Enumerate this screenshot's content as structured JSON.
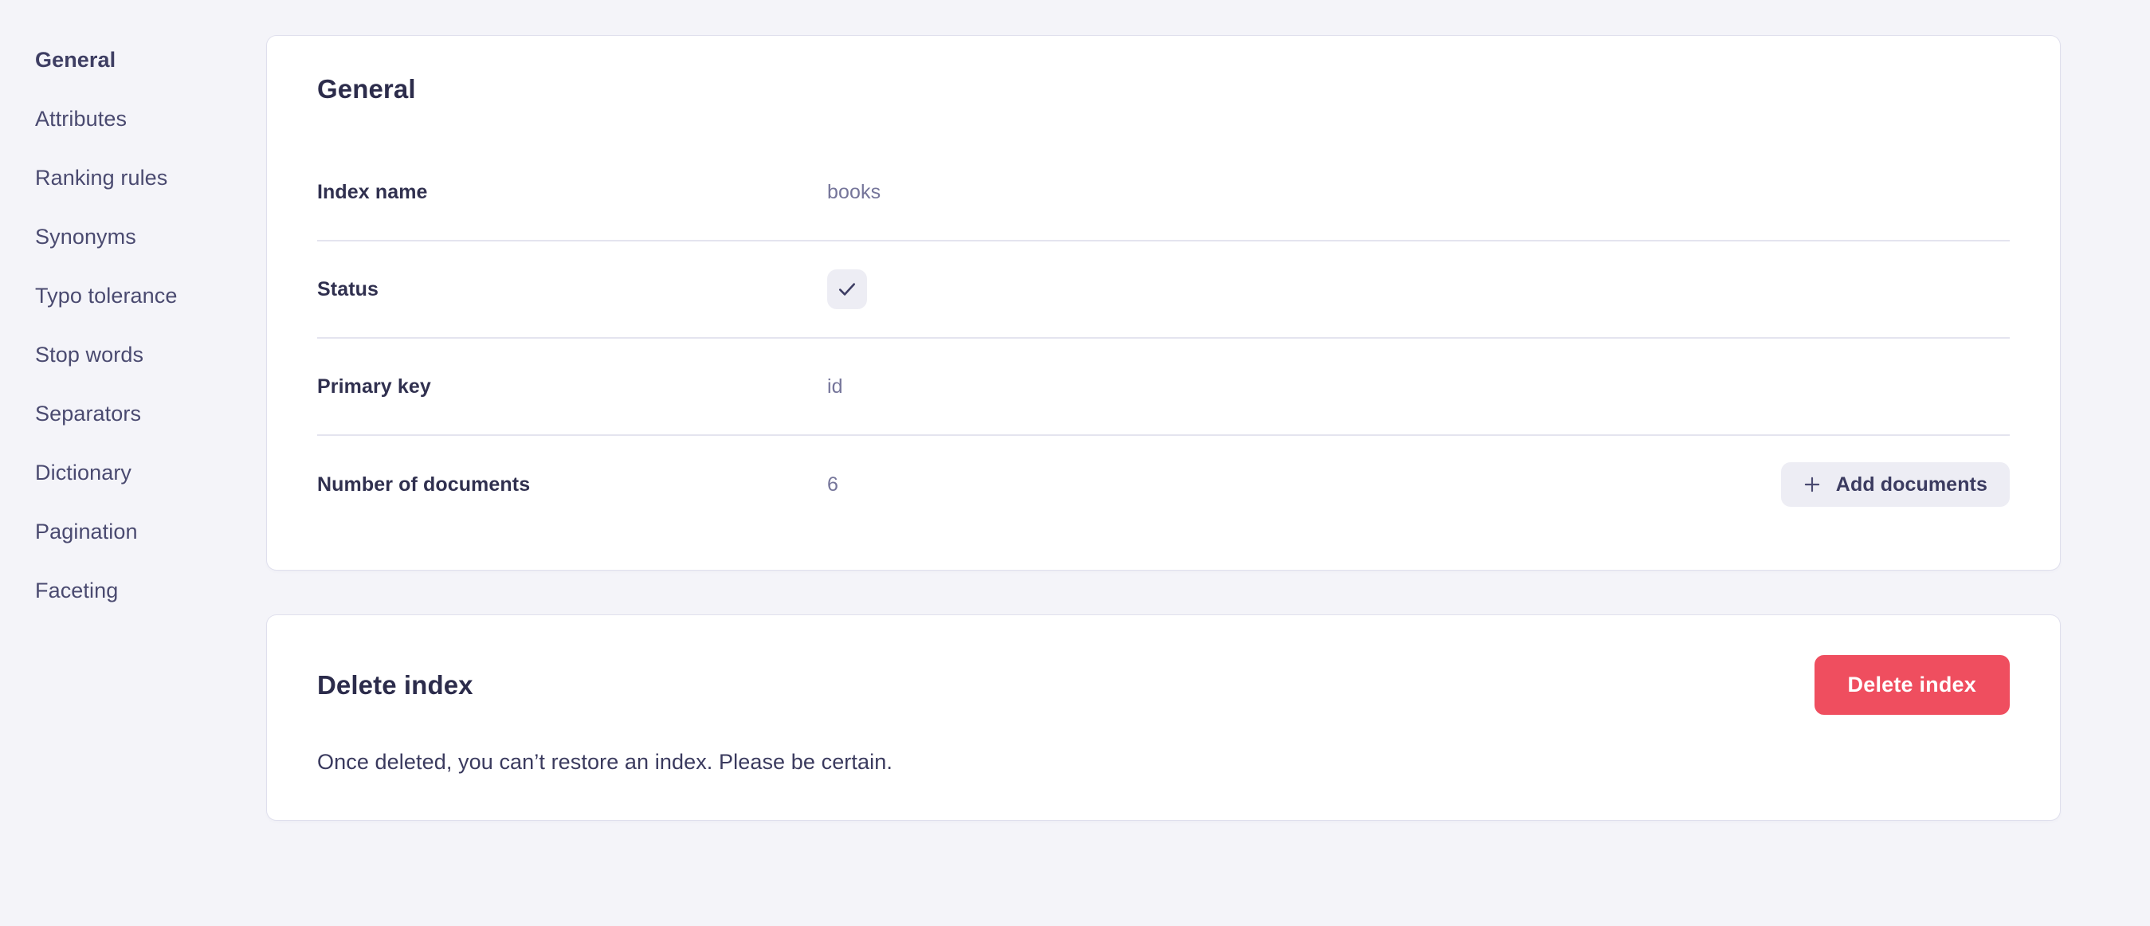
{
  "sidebar": {
    "items": [
      {
        "label": "General",
        "active": true
      },
      {
        "label": "Attributes",
        "active": false
      },
      {
        "label": "Ranking rules",
        "active": false
      },
      {
        "label": "Synonyms",
        "active": false
      },
      {
        "label": "Typo tolerance",
        "active": false
      },
      {
        "label": "Stop words",
        "active": false
      },
      {
        "label": "Separators",
        "active": false
      },
      {
        "label": "Dictionary",
        "active": false
      },
      {
        "label": "Pagination",
        "active": false
      },
      {
        "label": "Faceting",
        "active": false
      }
    ]
  },
  "general_card": {
    "title": "General",
    "rows": [
      {
        "label": "Index name",
        "value": "books"
      },
      {
        "label": "Status",
        "value": "",
        "icon": "check-icon"
      },
      {
        "label": "Primary key",
        "value": "id"
      },
      {
        "label": "Number of documents",
        "value": "6",
        "action": "Add documents",
        "action_icon": "plus-icon"
      }
    ],
    "add_documents_label": "Add documents"
  },
  "delete_card": {
    "title": "Delete index",
    "button_label": "Delete index",
    "description": "Once deleted, you can’t restore an index. Please be certain."
  },
  "colors": {
    "page_background": "#F4F4F9",
    "card_background": "#FFFFFF",
    "heading": "#2C2C4B",
    "label": "#30304F",
    "value": "#75759A",
    "divider": "#E4E4EF",
    "badge_background": "#EDEDF4",
    "danger": "#EF4E5F",
    "sidebar_text": "#4A4A70"
  }
}
